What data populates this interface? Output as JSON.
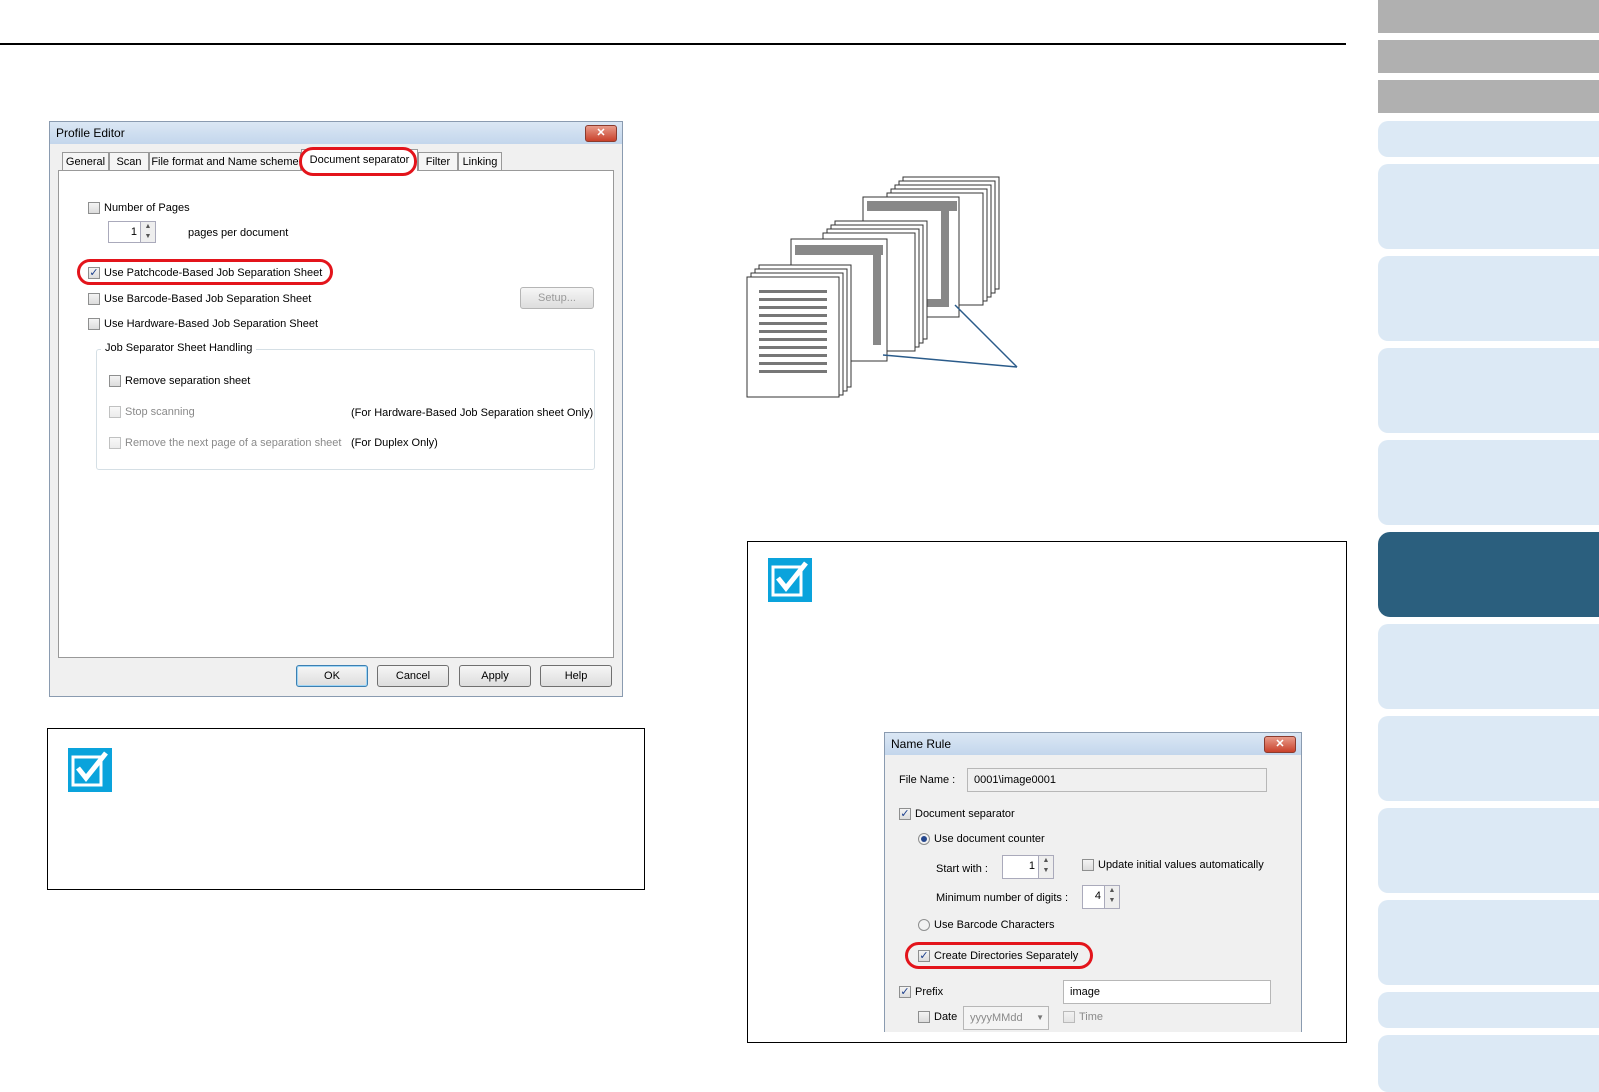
{
  "profile_editor": {
    "title": "Profile Editor",
    "close": "✕",
    "tabs": [
      "General",
      "Scan",
      "File format and Name scheme",
      "Document separator",
      "Filter",
      "Linking"
    ],
    "number_of_pages": {
      "label": "Number of Pages",
      "value": "1",
      "suffix": "pages per document",
      "checked": false
    },
    "patchcode": {
      "label": "Use Patchcode-Based Job Separation Sheet",
      "checked": true
    },
    "barcode": {
      "label": "Use Barcode-Based Job Separation Sheet",
      "checked": false
    },
    "setup_label": "Setup...",
    "hardware": {
      "label": "Use Hardware-Based Job Separation Sheet",
      "checked": false
    },
    "group_title": "Job Separator Sheet Handling",
    "remove_sheet": "Remove separation sheet",
    "stop_scanning": "Stop scanning",
    "stop_note": "(For Hardware-Based Job Separation sheet Only)",
    "remove_next": "Remove the next page of a separation sheet",
    "duplex_note": "(For Duplex Only)",
    "buttons": {
      "ok": "OK",
      "cancel": "Cancel",
      "apply": "Apply",
      "help": "Help"
    }
  },
  "name_rule": {
    "title": "Name Rule",
    "close": "✕",
    "file_name_label": "File Name :",
    "file_name_value": "0001\\image0001",
    "document_separator": "Document separator",
    "use_document_counter": "Use document counter",
    "start_with_label": "Start with :",
    "start_with_value": "1",
    "update_initial": "Update initial values automatically",
    "min_digits_label": "Minimum number of digits :",
    "min_digits_value": "4",
    "use_barcode_chars": "Use Barcode Characters",
    "create_directories": "Create Directories Separately",
    "prefix_label": "Prefix",
    "prefix_value": "image",
    "date_label": "Date",
    "date_format": "yyyyMMdd",
    "time_label": "Time"
  },
  "icons": {
    "check": "✓",
    "spin": "▲▼",
    "dropdown": "▼"
  },
  "colors": {
    "highlight": "#e3141b",
    "nav_active": "#2b5f7e",
    "nav_inactive": "#dce9f5",
    "note_icon": "#0aa3dc"
  }
}
